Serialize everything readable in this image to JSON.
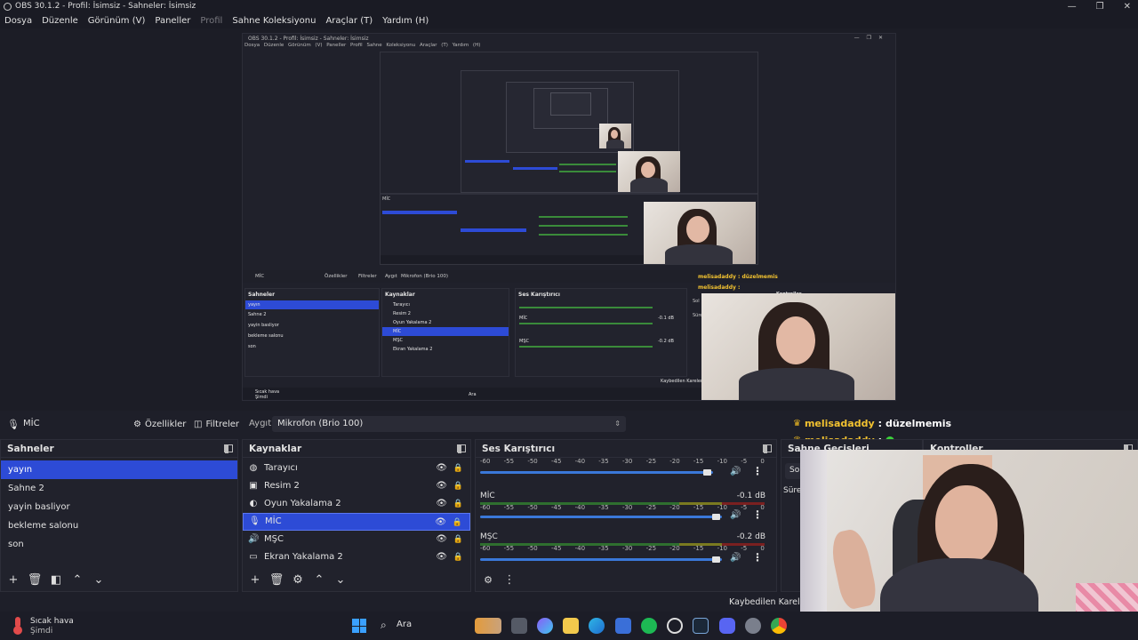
{
  "window": {
    "title": "OBS 30.1.2 - Profil: İsimsiz - Sahneler: İsimsiz",
    "minimize": "—",
    "maximize": "❐",
    "close": "✕"
  },
  "menu": {
    "items": [
      "Dosya",
      "Düzenle",
      "Görünüm (V)",
      "Paneller",
      "Profil",
      "Sahne Koleksiyonu",
      "Araçlar (T)",
      "Yardım (H)"
    ]
  },
  "source_bar": {
    "source_name": "MİC",
    "properties_label": "Özellikler",
    "filters_label": "Filtreler",
    "device_label": "Aygıt",
    "device_value": "Mikrofon (Brio 100)"
  },
  "chat": {
    "line1_user": "melisadaddy",
    "line1_sep": ":",
    "line1_msg": "düzelmemis",
    "line2_user": "melisadaddy",
    "line2_sep": ":"
  },
  "scenes": {
    "title": "Sahneler",
    "items": [
      "yayın",
      "Sahne 2",
      "yayin basliyor",
      "bekleme salonu",
      "son"
    ],
    "selected": 0
  },
  "sources": {
    "title": "Kaynaklar",
    "items": [
      {
        "label": "Tarayıcı",
        "icon": "globe-icon"
      },
      {
        "label": "Resim 2",
        "icon": "image-icon"
      },
      {
        "label": "Oyun Yakalama 2",
        "icon": "gamepad-icon"
      },
      {
        "label": "MİC",
        "icon": "mic-icon"
      },
      {
        "label": "MŞC",
        "icon": "speaker-icon"
      },
      {
        "label": "Ekran Yakalama 2",
        "icon": "monitor-icon"
      }
    ],
    "selected": 3
  },
  "mixer": {
    "title": "Ses Karıştırıcı",
    "scale": [
      "-60",
      "-55",
      "-50",
      "-45",
      "-40",
      "-35",
      "-30",
      "-25",
      "-20",
      "-15",
      "-10",
      "-5",
      "0"
    ],
    "tracks": [
      {
        "name": "",
        "db": ""
      },
      {
        "name": "MİC",
        "db": "-0.1 dB"
      },
      {
        "name": "MŞC",
        "db": "-0.2 dB"
      }
    ]
  },
  "transitions": {
    "title": "Sahne Geçişleri",
    "option": "Sol",
    "duration_label": "Süre"
  },
  "controls": {
    "title": "Kontroller"
  },
  "status": {
    "dropped_frames": "Kaybedilen Kareler 0"
  },
  "taskbar": {
    "weather_title": "Sıcak hava",
    "weather_sub": "Şimdi",
    "search_label": "Ara"
  },
  "mini_preview": {
    "title": "OBS 30.1.2 - Profil: İsimsiz - Sahneler: İsimsiz",
    "menu": "Dosya Düzenle Görünüm (V) Paneller Profil Sahne Koleksiyonu Araçlar (T) Yardım (H)",
    "source_name": "MİC",
    "properties": "Özellikler",
    "filters": "Filtreler",
    "device": "Aygıt",
    "device_value": "Mikrofon (Brio 100)",
    "chat1": "melisadaddy : düzelmemis",
    "chat2": "melisadaddy :",
    "scenes_title": "Sahneler",
    "scenes": [
      "yayın",
      "Sahne 2",
      "yayin basliyor",
      "bekleme salonu",
      "son"
    ],
    "sources_title": "Kaynaklar",
    "sources": [
      "Tarayıcı",
      "Resim 2",
      "Oyun Yakalama 2",
      "MİC",
      "MŞC",
      "Ekran Yakalama 2"
    ],
    "mixer_title": "Ses Karıştırıcı",
    "mic_db": "-0.1 dB",
    "msc_db": "-0.2 dB",
    "weather": "Sıcak hava",
    "weather_sub": "Şimdi",
    "search": "Ara",
    "controls": "Kontroller",
    "transitions_option": "Sol",
    "duration": "Süre",
    "dropped": "Kaybedilen Kareler 0"
  }
}
